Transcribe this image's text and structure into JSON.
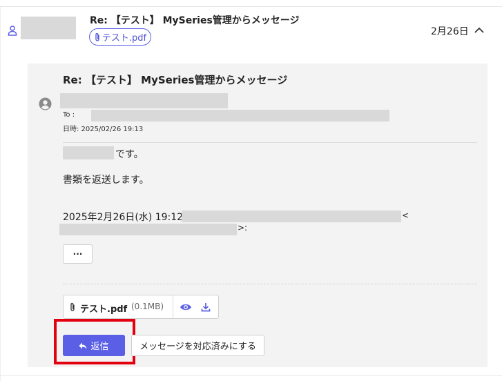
{
  "thread": {
    "subject": "Re: 【テスト】 MySeries管理からメッセージ",
    "attachment_chip_label": "テスト.pdf",
    "date": "2月26日"
  },
  "message": {
    "subject": "Re: 【テスト】 MySeries管理からメッセージ",
    "to_label": "To   :",
    "datetime_label": "日時:  2025/02/26 19:13",
    "body": {
      "greeting_suffix": "です。",
      "line1": "書類を返送します。",
      "quote_header": "2025年2月26日(水) 19:12",
      "quote_lt": "<",
      "quote_gt": ">:"
    },
    "more_label": "···"
  },
  "attachment": {
    "name": "テスト.pdf",
    "size": "(0.1MB)"
  },
  "actions": {
    "reply_label": "返信",
    "mark_handled_label": "メッセージを対応済みにする"
  },
  "colors": {
    "accent": "#5b5fe6",
    "highlight": "#e3000f"
  },
  "icons": [
    "person-icon",
    "paperclip-icon",
    "chevron-up-icon",
    "avatar-icon",
    "eye-icon",
    "download-icon",
    "reply-icon"
  ]
}
